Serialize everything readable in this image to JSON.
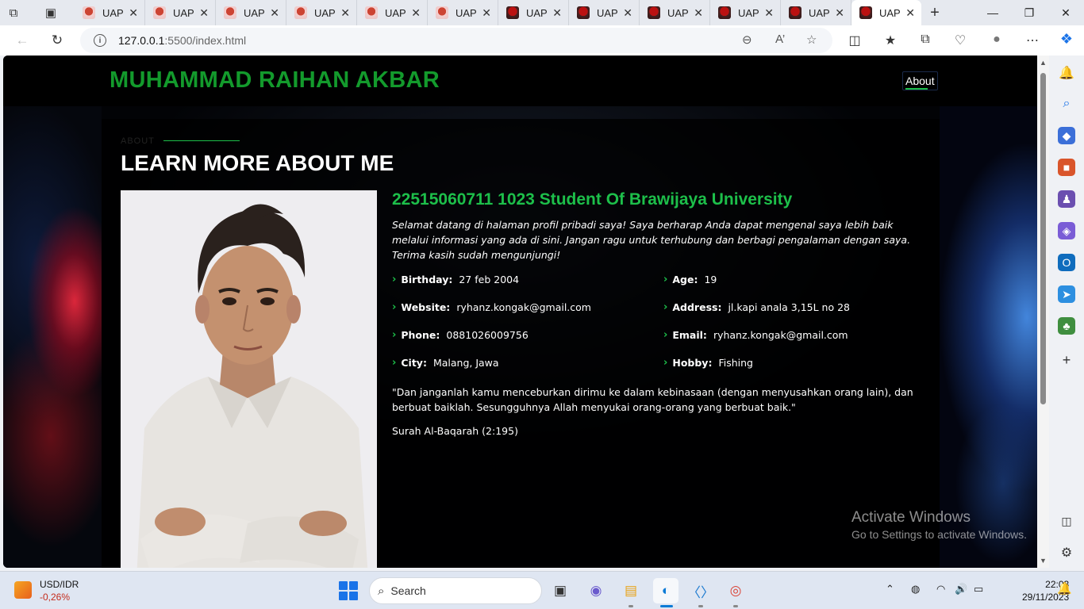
{
  "browser": {
    "tabs": [
      {
        "label": "UAP",
        "favicon": "light"
      },
      {
        "label": "UAP",
        "favicon": "light"
      },
      {
        "label": "UAP",
        "favicon": "light"
      },
      {
        "label": "UAP",
        "favicon": "light"
      },
      {
        "label": "UAP",
        "favicon": "light"
      },
      {
        "label": "UAP",
        "favicon": "light"
      },
      {
        "label": "UAP",
        "favicon": "dark"
      },
      {
        "label": "UAP",
        "favicon": "dark"
      },
      {
        "label": "UAP",
        "favicon": "dark"
      },
      {
        "label": "UAP",
        "favicon": "dark"
      },
      {
        "label": "UAP",
        "favicon": "dark"
      },
      {
        "label": "UAP",
        "favicon": "dark",
        "active": true
      }
    ],
    "url_host": "127.0.0.1",
    "url_rest": ":5500/index.html"
  },
  "site": {
    "name": "MUHAMMAD RAIHAN AKBAR",
    "nav_about": "About",
    "section_label": "ABOUT",
    "section_title": "LEARN MORE ABOUT ME",
    "headline": "22515060711 1023 Student Of Brawijaya University",
    "intro": "Selamat datang di halaman profil pribadi saya! Saya berharap Anda dapat mengenal saya lebih baik melalui informasi yang ada di sini. Jangan ragu untuk terhubung dan berbagi pengalaman dengan saya. Terima kasih sudah mengunjungi!",
    "info": [
      {
        "label": "Birthday:",
        "value": "27 feb 2004"
      },
      {
        "label": "Age:",
        "value": "19"
      },
      {
        "label": "Website:",
        "value": "ryhanz.kongak@gmail.com"
      },
      {
        "label": "Address:",
        "value": "jl.kapi anala 3,15L no 28"
      },
      {
        "label": "Phone:",
        "value": "0881026009756"
      },
      {
        "label": "Email:",
        "value": "ryhanz.kongak@gmail.com"
      },
      {
        "label": "City:",
        "value": "Malang, Jawa"
      },
      {
        "label": "Hobby:",
        "value": "Fishing"
      }
    ],
    "quote": "\"Dan janganlah kamu menceburkan dirimu ke dalam kebinasaan (dengan menyusahkan orang lain), dan berbuat baiklah. Sesungguhnya Allah menyukai orang-orang yang berbuat baik.\"",
    "quote_source": "Surah Al-Baqarah (2:195)"
  },
  "watermark": {
    "line1": "Activate Windows",
    "line2": "Go to Settings to activate Windows."
  },
  "taskbar": {
    "stock_pair": "USD/IDR",
    "stock_change": "-0,26%",
    "search_placeholder": "Search",
    "time": "22:03",
    "date": "29/11/2023"
  },
  "colors": {
    "accent_green": "#1dbf4a",
    "name_green": "#139a2c"
  }
}
